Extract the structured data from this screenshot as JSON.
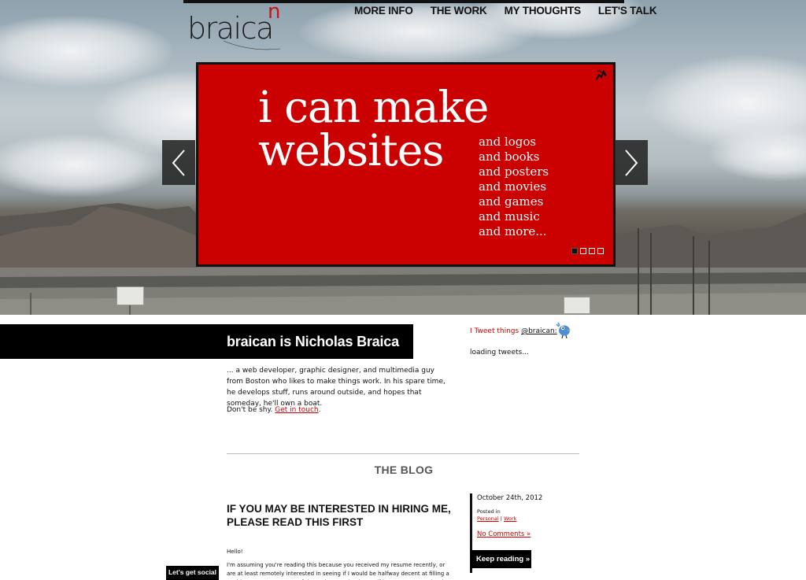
{
  "site": {
    "logo": {
      "text": "braica",
      "superscript": "n"
    },
    "nav": [
      "MORE INFO",
      "THE WORK",
      "MY THOUGHTS",
      "LET'S TALK"
    ]
  },
  "slider": {
    "headline_line1": "i can make",
    "headline_line2": "websites",
    "list": [
      "and logos",
      "and books",
      "and posters",
      "and movies",
      "and games",
      "and music",
      "and more..."
    ],
    "dots_total": 4,
    "active_dot": 1,
    "colors": {
      "panel": "#cb0000",
      "text": "#ffffff"
    }
  },
  "about": {
    "heading": "braican is Nicholas Braica",
    "paragraph": "... a web developer, graphic designer, and multimedia guy from Boston who likes to make things work. In his spare time, he develops stuff, runs around outside, and hopes that someday, he'll own a boat.",
    "cta_prefix": "Don't be shy. ",
    "cta_link": "Get in touch",
    "cta_suffix": "."
  },
  "twitter": {
    "label": "I Tweet things ",
    "handle": "@braican:",
    "status": "loading tweets...",
    "icon": "twitter-bird-icon"
  },
  "blog": {
    "section_title": "THE BLOG",
    "post": {
      "title": "IF YOU MAY BE INTERESTED IN HIRING ME, PLEASE READ THIS FIRST",
      "greeting": "Hello!",
      "excerpt": "I'm assuming you're reading this because you received my resume recently, or are at least remotely interested in seeing if I would be halfway decent at filling a position at your company. If that's the case (and even if it's not, I suppose), I'd like to personally welcome you to the site.",
      "date": "October 24th, 2012",
      "posted_in_label": "Posted in",
      "categories": [
        "Personal",
        "Work"
      ],
      "comments": "No Comments »",
      "keep_reading": "Keep reading »"
    }
  },
  "social": {
    "label": "Let's get social"
  }
}
